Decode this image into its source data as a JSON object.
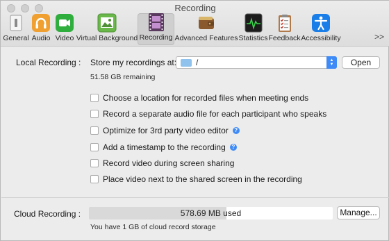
{
  "window": {
    "title": "Recording"
  },
  "toolbar": {
    "items": [
      {
        "label": "General",
        "icon": "general-icon",
        "selected": false
      },
      {
        "label": "Audio",
        "icon": "headphones-icon",
        "selected": false
      },
      {
        "label": "Video",
        "icon": "video-camera-icon",
        "selected": false
      },
      {
        "label": "Virtual Background",
        "icon": "picture-icon",
        "selected": false
      },
      {
        "label": "Recording",
        "icon": "film-strip-icon",
        "selected": true
      },
      {
        "label": "Advanced Features",
        "icon": "wallet-icon",
        "selected": false
      },
      {
        "label": "Statistics",
        "icon": "activity-monitor-icon",
        "selected": false
      },
      {
        "label": "Feedback",
        "icon": "clipboard-checklist-icon",
        "selected": false
      },
      {
        "label": "Accessibility",
        "icon": "accessibility-icon",
        "selected": false
      }
    ],
    "overflow": ">>"
  },
  "local": {
    "label": "Local Recording :",
    "store_label": "Store my recordings at:",
    "path": "/",
    "open_button": "Open",
    "remaining": "51.58 GB remaining",
    "options": [
      {
        "label": "Choose a location for recorded files when meeting ends",
        "checked": false,
        "help": false
      },
      {
        "label": "Record a separate audio file for each participant who speaks",
        "checked": false,
        "help": false
      },
      {
        "label": "Optimize for 3rd party video editor",
        "checked": false,
        "help": true
      },
      {
        "label": "Add a timestamp to the recording",
        "checked": false,
        "help": true
      },
      {
        "label": "Record video during screen sharing",
        "checked": false,
        "help": false
      },
      {
        "label": "Place video next to the shared screen in the recording",
        "checked": false,
        "help": false
      }
    ]
  },
  "cloud": {
    "label": "Cloud Recording :",
    "usage_text": "578.69 MB used",
    "usage_fraction": 0.565,
    "manage_button": "Manage...",
    "storage_note": "You have 1 GB of cloud record storage"
  },
  "colors": {
    "accent": "#3e8af6",
    "audio_icon": "#f0a030",
    "video_icon": "#2fae3e",
    "virtual_bg_icon": "#6ab84a",
    "accessibility_icon": "#1a7ee8"
  }
}
